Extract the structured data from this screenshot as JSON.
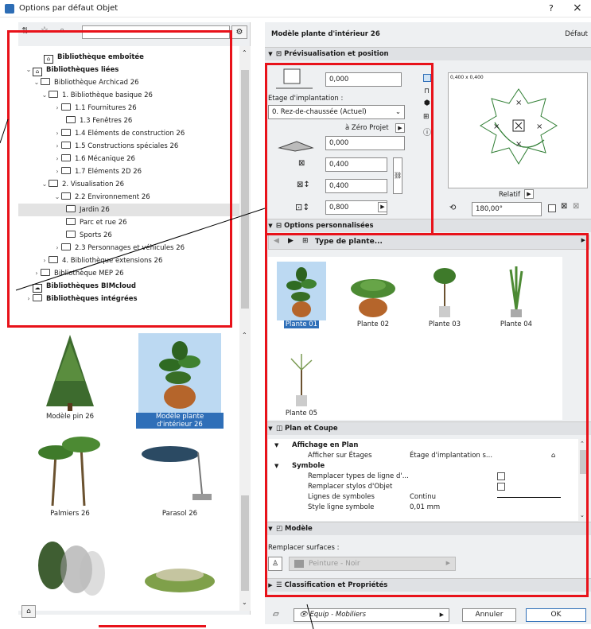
{
  "window": {
    "title": "Options par défaut Objet",
    "help": "?",
    "close": "×"
  },
  "library_tree": [
    {
      "label": "Bibliothèque emboîtée",
      "bold": true,
      "chev": "",
      "icon": "lib"
    },
    {
      "label": "Bibliothèques liées",
      "bold": true,
      "chev": "⌄",
      "icon": "lib"
    },
    {
      "label": "Bibliothèque Archicad 26",
      "bold": false,
      "chev": "⌄",
      "icon": "folder"
    },
    {
      "label": "1. Bibliothèque basique 26",
      "bold": false,
      "chev": "⌄",
      "icon": "folder"
    },
    {
      "label": "1.1 Fournitures 26",
      "bold": false,
      "chev": "›",
      "icon": "folder"
    },
    {
      "label": "1.3 Fenêtres 26",
      "bold": false,
      "chev": "",
      "icon": "folder"
    },
    {
      "label": "1.4 Eléments de construction 26",
      "bold": false,
      "chev": "›",
      "icon": "folder"
    },
    {
      "label": "1.5 Constructions spéciales 26",
      "bold": false,
      "chev": "›",
      "icon": "folder"
    },
    {
      "label": "1.6 Mécanique 26",
      "bold": false,
      "chev": "›",
      "icon": "folder"
    },
    {
      "label": "1.7 Eléments 2D 26",
      "bold": false,
      "chev": "›",
      "icon": "folder"
    },
    {
      "label": "2. Visualisation 26",
      "bold": false,
      "chev": "⌄",
      "icon": "folder"
    },
    {
      "label": "2.2 Environnement 26",
      "bold": false,
      "chev": "⌄",
      "icon": "folder"
    },
    {
      "label": "Jardin 26",
      "bold": false,
      "chev": "",
      "icon": "folder"
    },
    {
      "label": "Parc et rue 26",
      "bold": false,
      "chev": "",
      "icon": "folder"
    },
    {
      "label": "Sports 26",
      "bold": false,
      "chev": "",
      "icon": "folder"
    },
    {
      "label": "2.3 Personnages et véhicules 26",
      "bold": false,
      "chev": "›",
      "icon": "folder"
    },
    {
      "label": "4. Bibliothèque extensions 26",
      "bold": false,
      "chev": "›",
      "icon": "folder"
    },
    {
      "label": "Bibliothèque MEP 26",
      "bold": false,
      "chev": "›",
      "icon": "folder"
    },
    {
      "label": "Bibliothèques BIMcloud",
      "bold": true,
      "chev": "",
      "icon": "cloud"
    },
    {
      "label": "Bibliothèques intégrées",
      "bold": true,
      "chev": "›",
      "icon": "folder"
    }
  ],
  "thumbnails": [
    {
      "label": "Modèle pin 26"
    },
    {
      "label": "Modèle plante d'intérieur 26"
    },
    {
      "label": "Palmiers 26"
    },
    {
      "label": "Parasol 26"
    }
  ],
  "object_name": "Modèle plante d'intérieur 26",
  "object_default": "Défaut",
  "sections": {
    "preview": "Prévisualisation et position",
    "custom": "Options personnalisées",
    "plan": "Plan et Coupe",
    "model": "Modèle",
    "classification": "Classification et Propriétés"
  },
  "position": {
    "height_offset": "0,000",
    "etage_label": "Etage d'implantation :",
    "etage_value": "0. Rez-de-chaussée (Actuel)",
    "zero_label": "à Zéro Projet",
    "zero_value": "0,000",
    "width": "0,400",
    "depth": "0,400",
    "height": "0,800",
    "preview_size": "0,400 x 0,400",
    "relatif": "Relatif",
    "angle": "180,00°"
  },
  "plant_type": "Type de plante...",
  "plants": [
    {
      "label": "Plante 01"
    },
    {
      "label": "Plante 02"
    },
    {
      "label": "Plante 03"
    },
    {
      "label": "Plante 04"
    },
    {
      "label": "Plante 05"
    }
  ],
  "plan_rows": [
    {
      "label": "Affichage en Plan",
      "value": "",
      "bold": true
    },
    {
      "label": "Afficher sur Étages",
      "value": "Étage d'implantation s...",
      "bold": false
    },
    {
      "label": "Symbole",
      "value": "",
      "bold": true
    },
    {
      "label": "Remplacer types de ligne d'...",
      "value": "",
      "bold": false
    },
    {
      "label": "Remplacer stylos d'Objet",
      "value": "",
      "bold": false
    },
    {
      "label": "Lignes de symboles",
      "value": "Continu",
      "bold": false
    },
    {
      "label": "Style ligne symbole",
      "value": "0,01 mm",
      "bold": false
    }
  ],
  "model": {
    "surfaces_label": "Remplacer surfaces :",
    "surface_value": "Peinture - Noir"
  },
  "footer": {
    "layer": "Equip - Mobiliers",
    "cancel": "Annuler",
    "ok": "OK"
  },
  "colors": {
    "accent": "#2f6fb8",
    "highlight": "#e8121a",
    "selection": "#bcd9f2"
  }
}
